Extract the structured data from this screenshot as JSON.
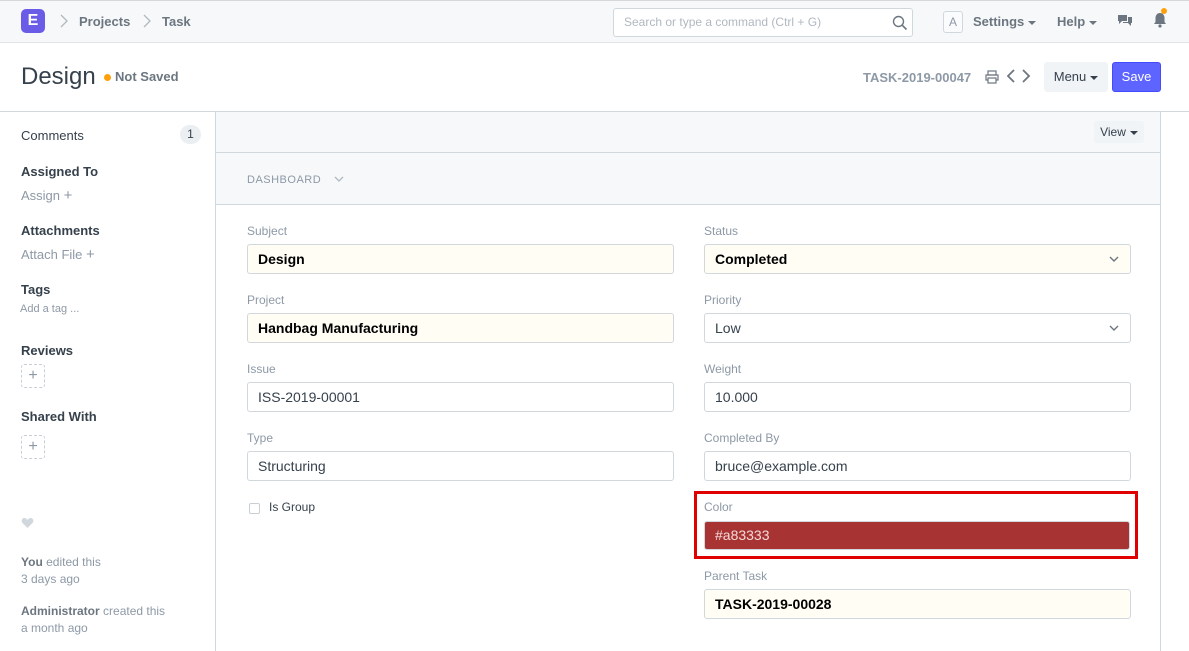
{
  "navbar": {
    "logo_letter": "E",
    "breadcrumbs": [
      "Projects",
      "Task"
    ],
    "search_placeholder": "Search or type a command (Ctrl + G)",
    "avatar_letter": "A",
    "settings_label": "Settings",
    "help_label": "Help"
  },
  "page": {
    "title": "Design",
    "status": "Not Saved",
    "doc_name": "TASK-2019-00047",
    "menu_label": "Menu",
    "save_label": "Save"
  },
  "sidebar": {
    "comments_label": "Comments",
    "comments_count": "1",
    "assigned_to_label": "Assigned To",
    "assign_link": "Assign",
    "attachments_label": "Attachments",
    "attach_link": "Attach File",
    "tags_label": "Tags",
    "add_tag_link": "Add a tag ...",
    "reviews_label": "Reviews",
    "shared_with_label": "Shared With",
    "activity": [
      {
        "who": "You",
        "what": " edited this",
        "when": "3 days ago"
      },
      {
        "who": "Administrator",
        "what": " created this",
        "when": "a month ago"
      }
    ]
  },
  "form": {
    "view_label": "View",
    "dashboard_label": "DASHBOARD",
    "subject": {
      "label": "Subject",
      "value": "Design"
    },
    "project": {
      "label": "Project",
      "value": "Handbag Manufacturing"
    },
    "issue": {
      "label": "Issue",
      "value": "ISS-2019-00001"
    },
    "type": {
      "label": "Type",
      "value": "Structuring"
    },
    "is_group": {
      "label": "Is Group",
      "checked": false
    },
    "status": {
      "label": "Status",
      "value": "Completed"
    },
    "priority": {
      "label": "Priority",
      "value": "Low"
    },
    "weight": {
      "label": "Weight",
      "value": "10.000"
    },
    "completed_by": {
      "label": "Completed By",
      "value": "bruce@example.com"
    },
    "color": {
      "label": "Color",
      "value": "#a83333"
    },
    "parent_task": {
      "label": "Parent Task",
      "value": "TASK-2019-00028"
    }
  },
  "colors": {
    "accent": "#5e64ff",
    "logo": "#6b5ce7",
    "indicator": "#ffa00a",
    "highlight": "#e00000",
    "color_field": "#a83333"
  }
}
